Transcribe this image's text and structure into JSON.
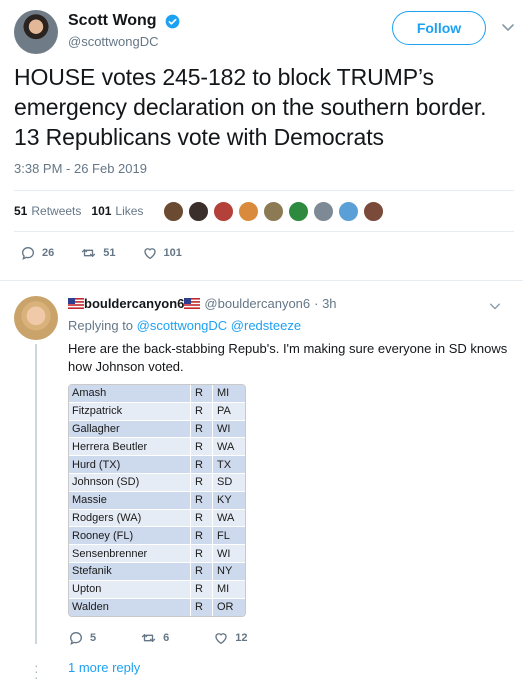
{
  "tweet": {
    "author_name": "Scott Wong",
    "author_handle": "@scottwongDC",
    "follow_label": "Follow",
    "text": "HOUSE votes 245-182 to block TRUMP’s emergency declaration on the southern border. 13 Republicans vote with Democrats",
    "timestamp": "3:38 PM - 26 Feb 2019",
    "retweets_count": "51",
    "retweets_label": "Retweets",
    "likes_count": "101",
    "likes_label": "Likes",
    "actions": {
      "replies": "26",
      "retweets": "51",
      "likes": "101"
    }
  },
  "reply": {
    "author_name": "bouldercanyon6",
    "author_handle": "@bouldercanyon6",
    "age": "· 3h",
    "replying_prefix": "Replying to",
    "replying_users": "@scottwongDC @redsteeze",
    "text": "Here are the back-stabbing Repub's. I'm making sure everyone in SD knows how Johnson voted.",
    "table": [
      {
        "name": "Amash",
        "party": "R",
        "state": "MI"
      },
      {
        "name": "Fitzpatrick",
        "party": "R",
        "state": "PA"
      },
      {
        "name": "Gallagher",
        "party": "R",
        "state": "WI"
      },
      {
        "name": "Herrera Beutler",
        "party": "R",
        "state": "WA"
      },
      {
        "name": "Hurd (TX)",
        "party": "R",
        "state": "TX"
      },
      {
        "name": "Johnson (SD)",
        "party": "R",
        "state": "SD"
      },
      {
        "name": "Massie",
        "party": "R",
        "state": "KY"
      },
      {
        "name": "Rodgers (WA)",
        "party": "R",
        "state": "WA"
      },
      {
        "name": "Rooney (FL)",
        "party": "R",
        "state": "FL"
      },
      {
        "name": "Sensenbrenner",
        "party": "R",
        "state": "WI"
      },
      {
        "name": "Stefanik",
        "party": "R",
        "state": "NY"
      },
      {
        "name": "Upton",
        "party": "R",
        "state": "MI"
      },
      {
        "name": "Walden",
        "party": "R",
        "state": "OR"
      }
    ],
    "actions": {
      "replies": "5",
      "retweets": "6",
      "likes": "12"
    },
    "more_replies": "1 more reply"
  },
  "colors": {
    "accent": "#1da1f2",
    "muted": "#657786",
    "divider": "#e6ecf0"
  }
}
